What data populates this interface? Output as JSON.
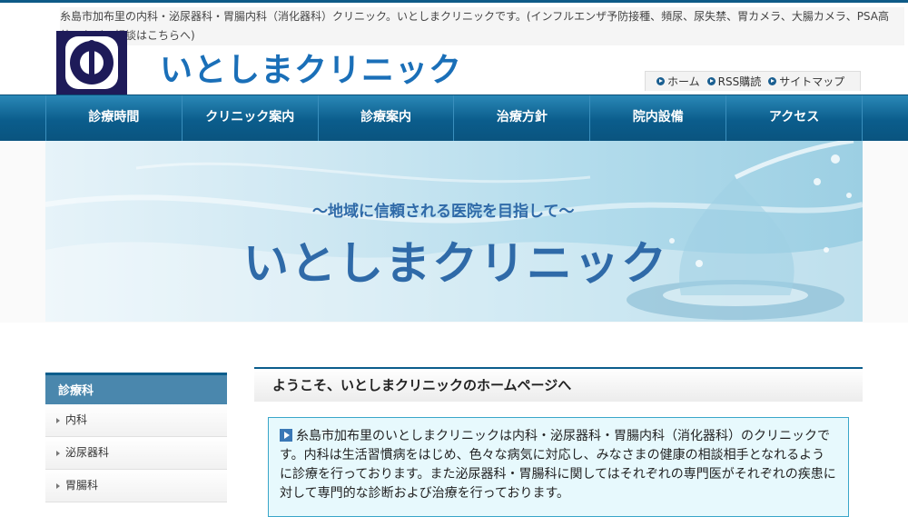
{
  "header": {
    "tagline": "糸島市加布里の内科・泌尿器科・胃腸内科（消化器科）クリニック。いとしまクリニックです。(インフルエンザ予防接種、頻尿、尿失禁、胃カメラ、大腸カメラ、PSA高値、などの相談はこちらへ)",
    "logo_text": "いとしまクリニック"
  },
  "util_nav": {
    "items": [
      "ホーム",
      "RSS購読",
      "サイトマップ"
    ]
  },
  "global_nav": {
    "items": [
      "診療時間",
      "クリニック案内",
      "診療案内",
      "治療方針",
      "院内設備",
      "アクセス"
    ]
  },
  "hero": {
    "subtitle": "～地域に信頼される医院を目指して～",
    "title": "いとしまクリニック"
  },
  "sidebar": {
    "heading": "診療科",
    "items": [
      "内科",
      "泌尿器科",
      "胃腸科"
    ]
  },
  "main": {
    "heading": "ようこそ、いとしまクリニックのホームページへ",
    "intro": "糸島市加布里のいとしまクリニックは内科・泌尿器科・胃腸内科（消化器科）のクリニックです。内科は生活習慣病をはじめ、色々な病気に対応し、みなさまの健康の相談相手となれるように診療を行っております。また泌尿器科・胃腸科に関してはそれぞれの専門医がそれぞれの疾患に対して専門的な診断および治療を行っております。"
  },
  "colors": {
    "nav_blue": "#0b5d8c",
    "logo_blue": "#1a6fb8",
    "badge_navy": "#1e1b59",
    "intro_bg": "#e7f9fd"
  }
}
